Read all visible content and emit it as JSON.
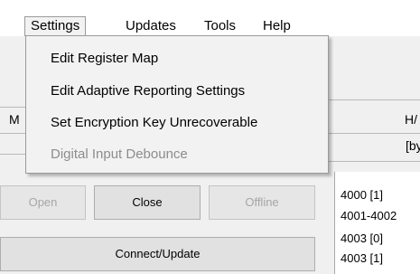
{
  "menubar": {
    "items": [
      {
        "label": "Settings",
        "active": true
      },
      {
        "label": "Updates"
      },
      {
        "label": "Tools"
      },
      {
        "label": "Help"
      }
    ]
  },
  "dropdown": {
    "items": [
      {
        "label": "Edit Register Map",
        "enabled": true
      },
      {
        "label": "Edit Adaptive Reporting Settings",
        "enabled": true
      },
      {
        "label": "Set Encryption Key Unrecoverable",
        "enabled": true
      },
      {
        "label": "Digital Input Debounce",
        "enabled": false
      }
    ]
  },
  "background": {
    "left_fragment": "M",
    "header_fragment": "H/",
    "subheader_fragment": "[by",
    "buttons": {
      "open": "Open",
      "close": "Close",
      "offline": "Offline",
      "connect": "Connect/Update"
    },
    "register_rows": [
      "4000 [1]",
      "4001-4002",
      "4003 [0]",
      "4003 [1]"
    ]
  }
}
